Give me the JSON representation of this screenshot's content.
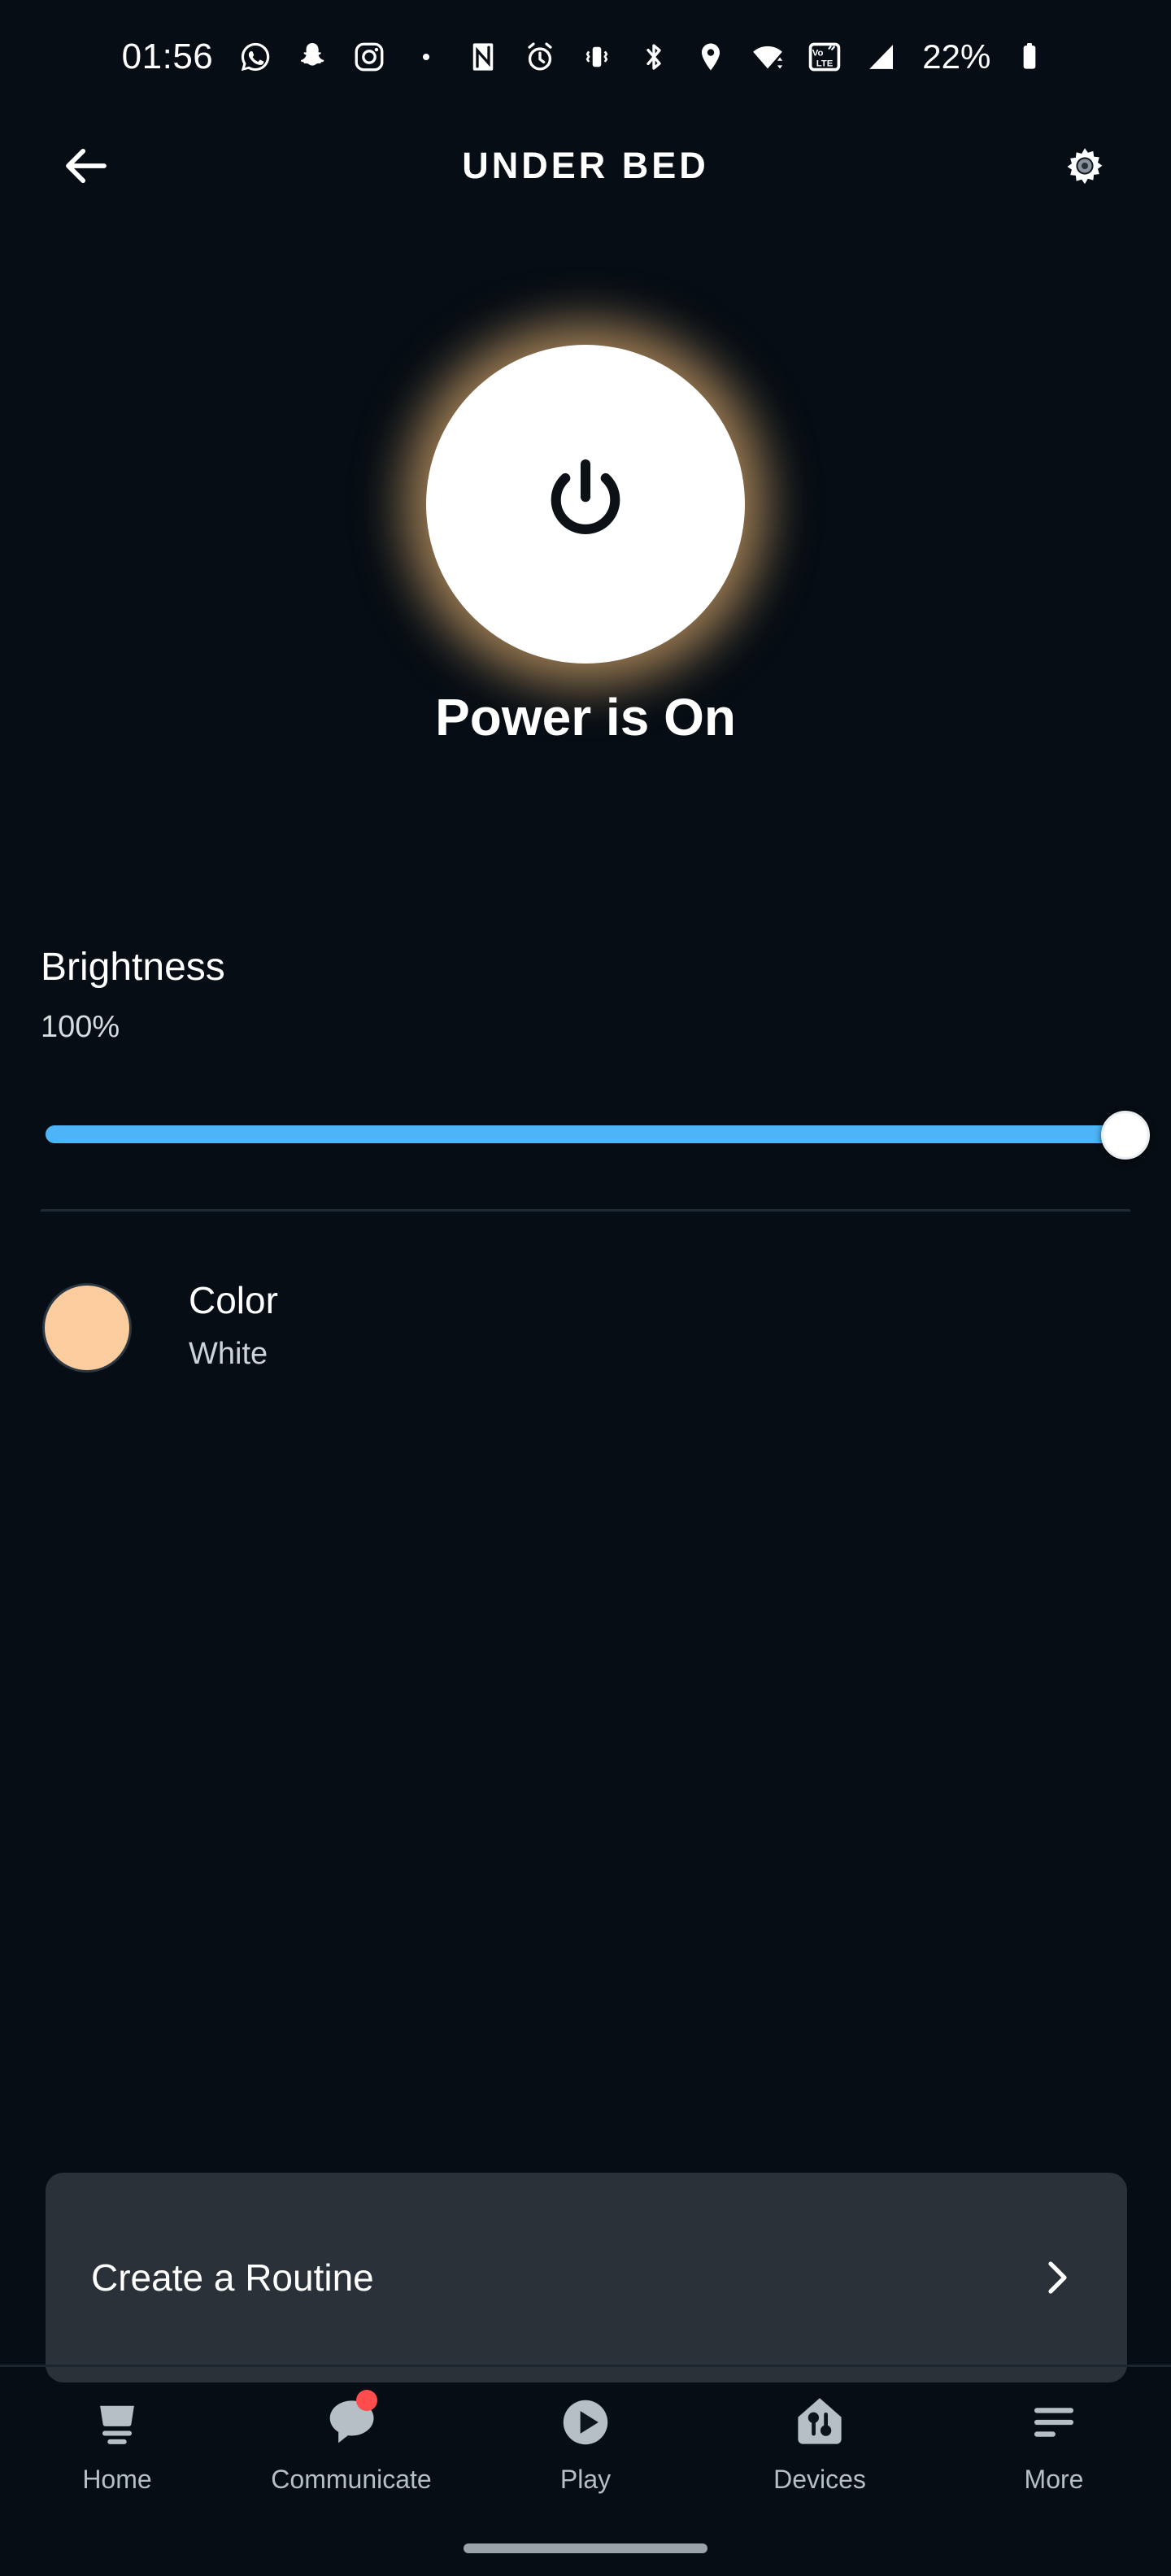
{
  "theme": {
    "background": "#060d14",
    "accent_slider": "#4cb4f7",
    "card_bg": "#2b3138",
    "badge_red": "#ff4d4d",
    "glow": "#ffc178",
    "nav_icon": "#b6bec6"
  },
  "status_bar": {
    "clock": "01:56",
    "battery_percent": "22%",
    "icons": [
      "whatsapp-icon",
      "snapchat-icon",
      "instagram-icon",
      "dot-icon",
      "nfc-icon",
      "alarm-icon",
      "vibrate-icon",
      "bluetooth-icon",
      "location-icon",
      "wifi-icon",
      "volte-icon",
      "signal-icon"
    ],
    "volte_top": "Vo",
    "volte_bottom": "LTE"
  },
  "header": {
    "title": "UNDER BED",
    "back_icon": "arrow-left-icon",
    "settings_icon": "gear-icon"
  },
  "power": {
    "icon": "power-icon",
    "status_text": "Power is On",
    "is_on": true
  },
  "brightness": {
    "label": "Brightness",
    "value_text": "100%",
    "value": 100,
    "min": 0,
    "max": 100
  },
  "color": {
    "label": "Color",
    "value": "White",
    "swatch_hex": "#fbcd9e"
  },
  "routine": {
    "label": "Create a Routine",
    "chevron_icon": "chevron-right-icon"
  },
  "bottom_nav": {
    "items": [
      {
        "label": "Home",
        "icon": "echo-device-icon",
        "badge": false
      },
      {
        "label": "Communicate",
        "icon": "speech-bubble-icon",
        "badge": true
      },
      {
        "label": "Play",
        "icon": "play-circle-icon",
        "badge": false
      },
      {
        "label": "Devices",
        "icon": "house-controls-icon",
        "badge": false
      },
      {
        "label": "More",
        "icon": "hamburger-menu-icon",
        "badge": false
      }
    ]
  }
}
